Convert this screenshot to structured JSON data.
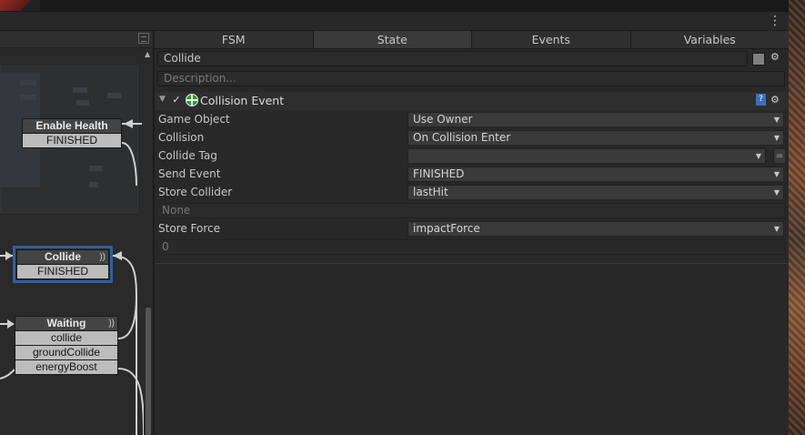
{
  "window": {
    "menu_glyph": "⋮"
  },
  "tabs": [
    {
      "label": "FSM",
      "active": false
    },
    {
      "label": "State",
      "active": true
    },
    {
      "label": "Events",
      "active": false
    },
    {
      "label": "Variables",
      "active": false
    }
  ],
  "state": {
    "name": "Collide",
    "description_placeholder": "Description..."
  },
  "action": {
    "enabled_glyph": "✓",
    "title": "Collision Event",
    "help_glyph": "?",
    "fields": {
      "game_object": {
        "label": "Game Object",
        "value": "Use Owner"
      },
      "collision": {
        "label": "Collision",
        "value": "On Collision Enter"
      },
      "collide_tag": {
        "label": "Collide Tag",
        "value": ""
      },
      "send_event": {
        "label": "Send Event",
        "value": "FINISHED"
      },
      "store_collider": {
        "label": "Store Collider",
        "value": "lastHit",
        "subvalue": "None"
      },
      "store_force": {
        "label": "Store Force",
        "value": "impactForce",
        "subvalue": "0"
      }
    }
  },
  "graph": {
    "nodes": {
      "enable_health": {
        "title": "Enable Health",
        "transitions": [
          "FINISHED"
        ]
      },
      "collide": {
        "title": "Collide",
        "transitions": [
          "FINISHED"
        ]
      },
      "waiting": {
        "title": "Waiting",
        "transitions": [
          "collide",
          "groundCollide",
          "energyBoost"
        ]
      }
    },
    "selected_node": "Collide"
  },
  "colors": {
    "panel_bg": "#282828",
    "selection": "#2f5f9f",
    "action_icon": "#2c9a2c",
    "help_icon": "#3c6fbf"
  },
  "icons": [
    "kebab-menu-icon",
    "fit-view-icon",
    "color-swatch-icon",
    "settings-gear-icon",
    "collapse-triangle-icon",
    "checkmark-icon",
    "collision-event-icon",
    "help-book-icon",
    "dropdown-caret-icon",
    "variable-toggle-icon",
    "pulse-icon",
    "scroll-up-icon"
  ]
}
